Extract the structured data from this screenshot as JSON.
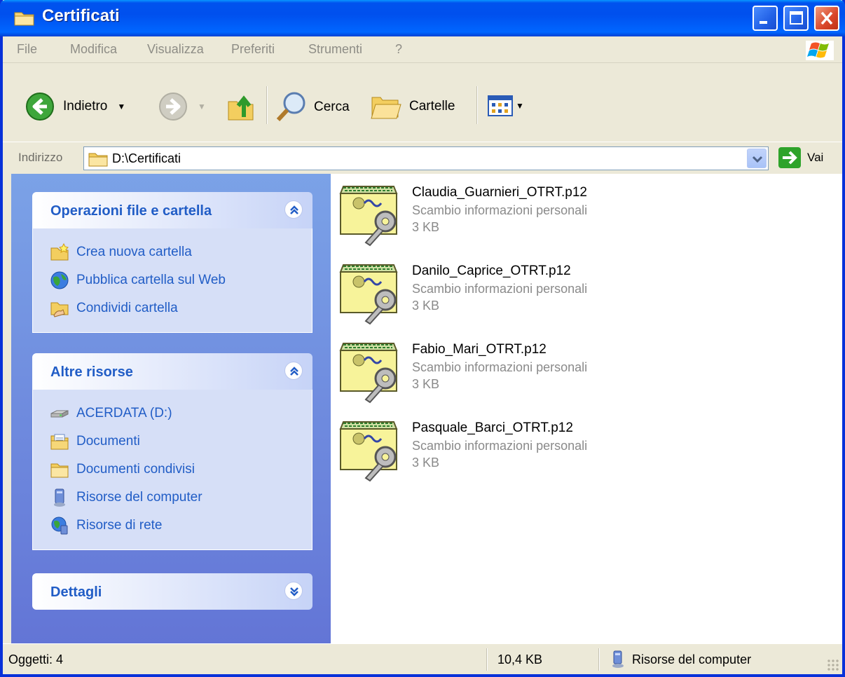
{
  "window": {
    "title": "Certificati"
  },
  "menu": {
    "items": [
      "File",
      "Modifica",
      "Visualizza",
      "Preferiti",
      "Strumenti",
      "?"
    ]
  },
  "toolbar": {
    "back_label": "Indietro",
    "search_label": "Cerca",
    "folders_label": "Cartelle"
  },
  "address": {
    "label": "Indirizzo",
    "value": "D:\\Certificati",
    "go_label": "Vai"
  },
  "taskpane": {
    "file_tasks": {
      "title": "Operazioni file e cartella",
      "items": [
        "Crea nuova cartella",
        "Pubblica cartella sul Web",
        "Condividi cartella"
      ]
    },
    "other_places": {
      "title": "Altre risorse",
      "items": [
        "ACERDATA (D:)",
        "Documenti",
        "Documenti condivisi",
        "Risorse del computer",
        "Risorse di rete"
      ]
    },
    "details": {
      "title": "Dettagli"
    }
  },
  "files": [
    {
      "name": "Claudia_Guarnieri_OTRT.p12",
      "type": "Scambio informazioni personali",
      "size": "3 KB"
    },
    {
      "name": "Danilo_Caprice_OTRT.p12",
      "type": "Scambio informazioni personali",
      "size": "3 KB"
    },
    {
      "name": "Fabio_Mari_OTRT.p12",
      "type": "Scambio informazioni personali",
      "size": "3 KB"
    },
    {
      "name": "Pasquale_Barci_OTRT.p12",
      "type": "Scambio informazioni personali",
      "size": "3 KB"
    }
  ],
  "status": {
    "objects": "Oggetti: 4",
    "size": "10,4 KB",
    "location": "Risorse del computer"
  }
}
